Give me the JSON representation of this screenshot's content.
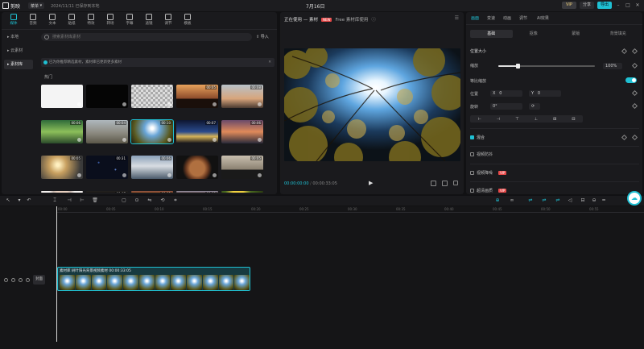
{
  "titlebar": {
    "app_name": "剪映",
    "menu_label": "菜单",
    "autosave_text": "2024/11/11 已保存到本地",
    "project_title": "7月16日",
    "vip_label": "VIP",
    "share_label": "分享",
    "export_label": "导出"
  },
  "media_tabs": [
    {
      "label": "媒体",
      "icon": "media-icon"
    },
    {
      "label": "音频",
      "icon": "audio-icon"
    },
    {
      "label": "文本",
      "icon": "text-icon"
    },
    {
      "label": "贴纸",
      "icon": "sticker-icon"
    },
    {
      "label": "特效",
      "icon": "effects-icon"
    },
    {
      "label": "转场",
      "icon": "transition-icon"
    },
    {
      "label": "字幕",
      "icon": "caption-icon"
    },
    {
      "label": "滤镜",
      "icon": "filter-icon"
    },
    {
      "label": "调节",
      "icon": "adjust-icon"
    },
    {
      "label": "模板",
      "icon": "template-icon"
    }
  ],
  "left_nav": [
    {
      "label": "本地",
      "active": false
    },
    {
      "label": "云素材",
      "active": false
    },
    {
      "label": "素材库",
      "active": true
    }
  ],
  "search": {
    "placeholder": "搜索素材库素材"
  },
  "import_label": "导入",
  "notice": {
    "text": "已为你推荐精选素材，素材库已更新更多素材"
  },
  "hot_label": "热门",
  "thumbnails": [
    {
      "dur": "",
      "style": "white"
    },
    {
      "dur": "",
      "style": "black"
    },
    {
      "dur": "",
      "style": "transparent"
    },
    {
      "dur": "00:05",
      "style": "sunset-people"
    },
    {
      "dur": "00:08",
      "style": "birds-sky"
    },
    {
      "dur": "00:06",
      "style": "green-forest"
    },
    {
      "dur": "00:04",
      "style": "stone-house"
    },
    {
      "dur": "00:10",
      "style": "trees-sun",
      "selected": true
    },
    {
      "dur": "00:07",
      "style": "city-night"
    },
    {
      "dur": "00:06",
      "style": "sunset-sea"
    },
    {
      "dur": "00:05",
      "style": "beach-sunset"
    },
    {
      "dur": "00:31",
      "style": "starry"
    },
    {
      "dur": "00:06",
      "style": "mountain-clouds"
    },
    {
      "dur": "",
      "style": "dog"
    },
    {
      "dur": "00:05",
      "style": "silhouette-couple"
    },
    {
      "dur": "",
      "style": "man-portrait"
    },
    {
      "dur": "00:07",
      "style": "dark-scene"
    },
    {
      "dur": "00:05",
      "style": "orange-sky"
    },
    {
      "dur": "00:03",
      "style": "city-dusk"
    },
    {
      "dur": "",
      "style": "yellow-flowers"
    }
  ],
  "player": {
    "title": "正在使用 — 素材",
    "badge": "NEW",
    "subtitle": "Free 素材库使用",
    "current_time": "00:00:00:00",
    "total_time": "00:00:33:05"
  },
  "props": {
    "tabs": [
      {
        "label": "画面",
        "active": true
      },
      {
        "label": "变速",
        "active": false
      },
      {
        "label": "动画",
        "active": false
      },
      {
        "label": "调节",
        "active": false
      },
      {
        "label": "AI效果",
        "active": false
      }
    ],
    "subtabs": [
      {
        "label": "基础",
        "active": true
      },
      {
        "label": "抠像",
        "active": false
      },
      {
        "label": "蒙版",
        "active": false
      },
      {
        "label": "背景填充",
        "active": false
      }
    ],
    "position_size_label": "位置大小",
    "scale_label": "缩放",
    "scale_value": "100%",
    "scale_fraction": 0.2,
    "uniform_label": "等比缩放",
    "position_label": "位置",
    "pos_x_label": "X",
    "pos_x": "0",
    "pos_y_label": "Y",
    "pos_y": "0",
    "rotate_label": "旋转",
    "rotate_value": "0°",
    "align_icons": [
      "⊢",
      "⊣",
      "⊤",
      "⊥",
      "⊞",
      "⊟"
    ],
    "blend_label": "混合",
    "stabilize_label": "视频防抖",
    "denoise_label": "视频降噪",
    "denoise_badge": "VIP",
    "enhance_label": "超清画质",
    "enhance_badge": "VIP"
  },
  "timeline": {
    "ticks": [
      "00:00",
      "00:05",
      "00:10",
      "00:15",
      "00:20",
      "00:25",
      "00:30",
      "00:35",
      "00:40",
      "00:45",
      "00:50",
      "00:55"
    ],
    "cover_label": "封面",
    "clip_title": "素材库 树叶阳光背景视频素材  00:00:33:05",
    "clip_frames": 12
  },
  "colors": {
    "accent": "#1fc0d3",
    "background": "#111113",
    "panel": "#1a1a1d"
  }
}
